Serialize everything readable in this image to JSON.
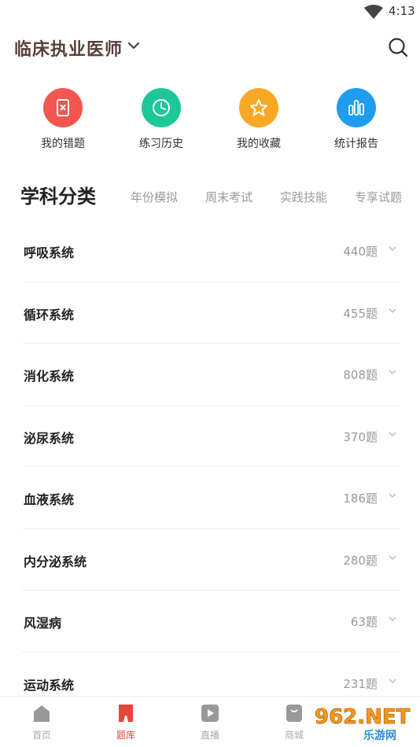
{
  "status_bar": {
    "time": "4:13"
  },
  "header": {
    "title": "临床执业医师"
  },
  "shortcuts": [
    {
      "label": "我的错题",
      "color": "#f2564f",
      "icon": "wrong-questions-icon"
    },
    {
      "label": "练习历史",
      "color": "#1ec79a",
      "icon": "clock-icon"
    },
    {
      "label": "我的收藏",
      "color": "#f9a825",
      "icon": "star-icon"
    },
    {
      "label": "统计报告",
      "color": "#1e9cf0",
      "icon": "bar-chart-icon"
    }
  ],
  "tabs": {
    "active": "学科分类",
    "items": [
      "年份模拟",
      "周末考试",
      "实践技能",
      "专享试题"
    ]
  },
  "subjects": [
    {
      "name": "呼吸系统",
      "count": "440题"
    },
    {
      "name": "循环系统",
      "count": "455题"
    },
    {
      "name": "消化系统",
      "count": "808题"
    },
    {
      "name": "泌尿系统",
      "count": "370题"
    },
    {
      "name": "血液系统",
      "count": "186题"
    },
    {
      "name": "内分泌系统",
      "count": "280题"
    },
    {
      "name": "风湿病",
      "count": "63题"
    },
    {
      "name": "运动系统",
      "count": "231题"
    }
  ],
  "tabbar": [
    {
      "label": "首页",
      "icon": "home-icon"
    },
    {
      "label": "题库",
      "icon": "question-bank-icon",
      "active": true
    },
    {
      "label": "直播",
      "icon": "live-icon"
    },
    {
      "label": "商城",
      "icon": "shop-icon"
    }
  ],
  "watermark": {
    "text": "962.NET",
    "subtext": "乐游网"
  }
}
